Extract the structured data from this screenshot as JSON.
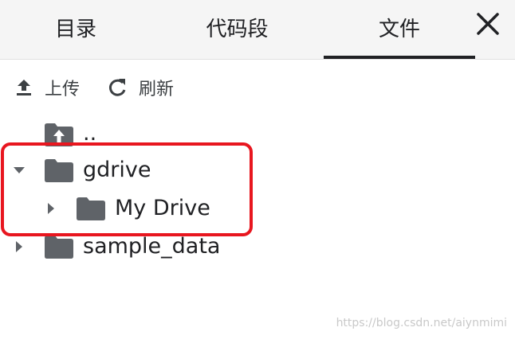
{
  "tabs": [
    {
      "label": "目录"
    },
    {
      "label": "代码段"
    },
    {
      "label": "文件",
      "active": true
    }
  ],
  "actions": {
    "upload_label": "上传",
    "refresh_label": "刷新"
  },
  "tree": [
    {
      "name": "..",
      "icon": "folder-up-icon",
      "depth": 0
    },
    {
      "name": "gdrive",
      "icon": "folder-icon",
      "expanded": true,
      "depth": 0
    },
    {
      "name": "My Drive",
      "icon": "folder-icon",
      "expanded": false,
      "depth": 1
    },
    {
      "name": "sample_data",
      "icon": "folder-icon",
      "expanded": false,
      "depth": 0
    }
  ],
  "watermark": "https://blog.csdn.net/aiynmimi",
  "colors": {
    "highlight": "#e8161f",
    "folder": "#5f6368",
    "tabbar": "#f5f5f5"
  }
}
